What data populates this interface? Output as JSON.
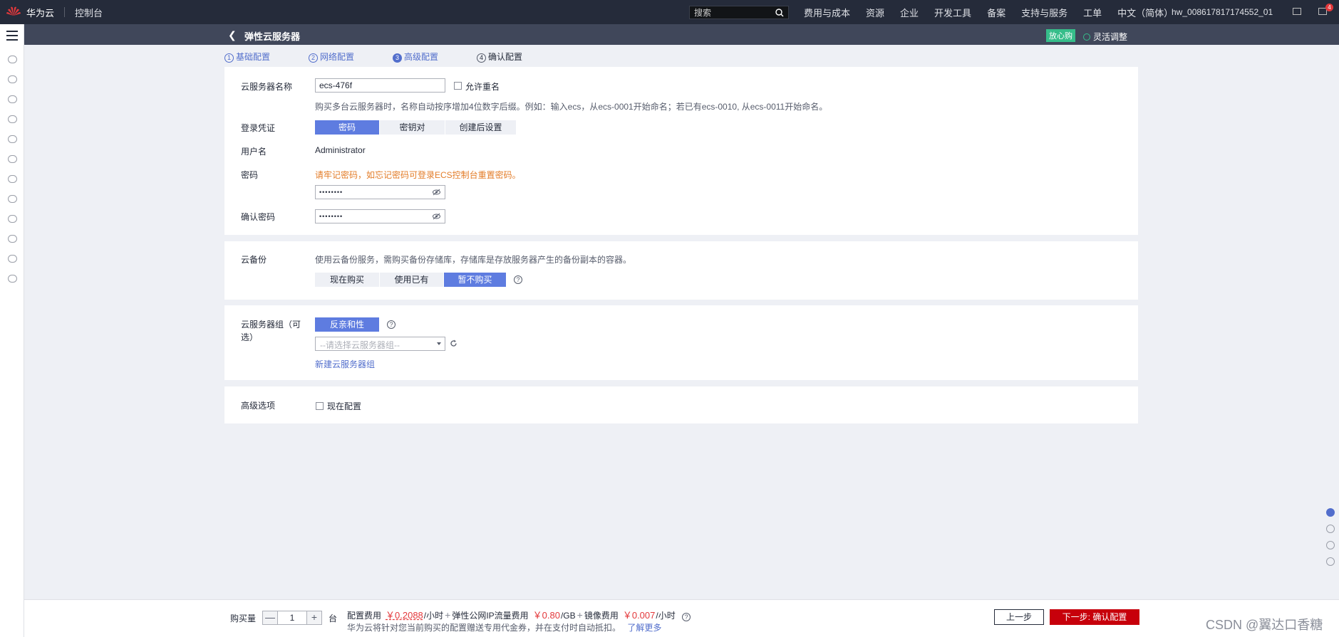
{
  "topbar": {
    "brand": "华为云",
    "console": "控制台",
    "search_placeholder": "搜索",
    "nav": [
      "费用与成本",
      "资源",
      "企业",
      "开发工具",
      "备案",
      "支持与服务",
      "工单",
      "中文（简体）"
    ],
    "username": "hw_008617817174552_01",
    "message_count": "4"
  },
  "subheader": {
    "title": "弹性云服务器",
    "tag": "放心购",
    "flex_label": "灵活调整"
  },
  "steps": [
    {
      "num": "1",
      "label": "基础配置"
    },
    {
      "num": "2",
      "label": "网络配置"
    },
    {
      "num": "3",
      "label": "高级配置"
    },
    {
      "num": "4",
      "label": "确认配置"
    }
  ],
  "basic": {
    "name_label": "云服务器名称",
    "name_value": "ecs-476f",
    "allow_dup_label": "允许重名",
    "name_hint": "购买多台云服务器时，名称自动按序增加4位数字后缀。例如：输入ecs，从ecs-0001开始命名；若已有ecs-0010, 从ecs-0011开始命名。",
    "cred_label": "登录凭证",
    "cred_options": [
      "密码",
      "密钥对",
      "创建后设置"
    ],
    "user_label": "用户名",
    "user_value": "Administrator",
    "pwd_label": "密码",
    "pwd_warning": "请牢记密码，如忘记密码可登录ECS控制台重置密码。",
    "pwd_value": "••••••••",
    "confirm_label": "确认密码",
    "confirm_value": "••••••••"
  },
  "backup": {
    "label": "云备份",
    "hint": "使用云备份服务，需购买备份存储库，存储库是存放服务器产生的备份副本的容器。",
    "options": [
      "现在购买",
      "使用已有",
      "暂不购买"
    ]
  },
  "group": {
    "label": "云服务器组（可选）",
    "policy": "反亲和性",
    "select_placeholder": "--请选择云服务器组--",
    "create_link": "新建云服务器组"
  },
  "advanced": {
    "label": "高级选项",
    "config_now": "现在配置"
  },
  "footer": {
    "qty_label": "购买量",
    "qty_minus": "—",
    "qty_value": "1",
    "qty_plus": "+",
    "qty_unit": "台",
    "fee1_label": "配置费用",
    "fee1_price": "￥0.2088",
    "fee1_unit": "/小时",
    "fee2_label": "弹性公网IP流量费用",
    "fee2_price": "￥0.80",
    "fee2_unit": "/GB",
    "fee3_label": "镜像费用",
    "fee3_price": "￥0.007",
    "fee3_unit": "/小时",
    "note": "华为云将针对您当前购买的配置赠送专用代金券，并在支付时自动抵扣。",
    "learn_more": "了解更多",
    "prev": "上一步",
    "next": "下一步: 确认配置"
  },
  "watermark": "CSDN @翼达口香糖"
}
